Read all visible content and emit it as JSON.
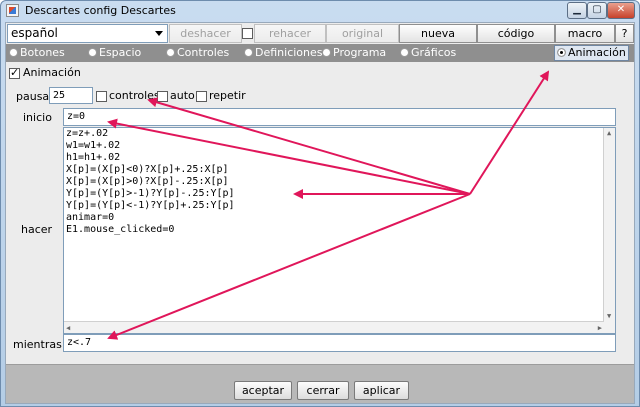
{
  "window": {
    "title": "Descartes config Descartes"
  },
  "toolbar": {
    "language": "español",
    "undo_label": "deshacer",
    "redo_label": "rehacer",
    "original_label": "original",
    "new_label": "nueva",
    "code_label": "código",
    "macro_label": "macro",
    "help_label": "?"
  },
  "tabs": [
    {
      "label": "Botones"
    },
    {
      "label": "Espacio"
    },
    {
      "label": "Controles"
    },
    {
      "label": "Definiciones"
    },
    {
      "label": "Programa"
    },
    {
      "label": "Gráficos"
    },
    {
      "label": "Animación",
      "selected": true
    }
  ],
  "animation": {
    "enable_label": "Animación",
    "enabled": true,
    "pause_label": "pausa",
    "pause_value": "25",
    "controls_label": "controles",
    "auto_label": "auto",
    "repeat_label": "repetir",
    "init_label": "inicio",
    "init_value": "z=0",
    "do_label": "hacer",
    "do_lines": [
      "z=z+.02",
      "w1=w1+.02",
      "h1=h1+.02",
      "X[p]=(X[p]<0)?X[p]+.25:X[p]",
      "X[p]=(X[p]>0)?X[p]-.25:X[p]",
      "Y[p]=(Y[p]>-1)?Y[p]-.25:Y[p]",
      "Y[p]=(Y[p]<-1)?Y[p]+.25:Y[p]",
      "animar=0",
      "E1.mouse_clicked=0"
    ],
    "while_label": "mientras",
    "while_value": "z<.7"
  },
  "footer": {
    "accept_label": "aceptar",
    "close_label": "cerrar",
    "apply_label": "aplicar"
  },
  "colors": {
    "annotation_arrow": "#e0165a",
    "tab_bar": "#8f8f8f",
    "footer": "#b8b8b8"
  },
  "icons": {
    "app": "descartes-app-icon",
    "minimize": "minimize-icon",
    "maximize": "maximize-icon",
    "close": "close-icon"
  }
}
